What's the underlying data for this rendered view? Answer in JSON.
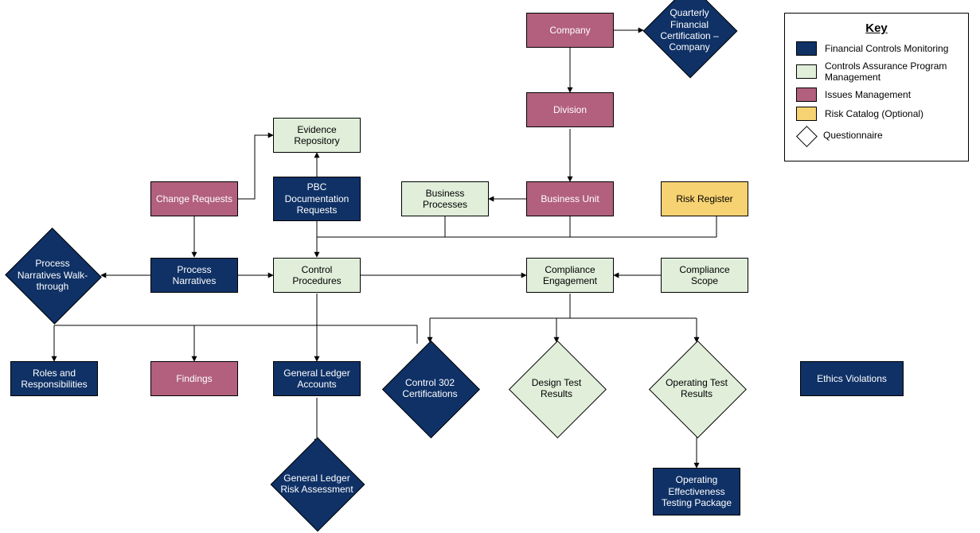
{
  "nodes": {
    "company": "Company",
    "quarterlyFinCert": "Quarterly Financial Certification – Company",
    "division": "Division",
    "evidenceRepo": "Evidence Repository",
    "changeRequests": "Change Requests",
    "pbcDocRequests": "PBC Documentation Requests",
    "bizProcesses": "Business Processes",
    "businessUnit": "Business Unit",
    "riskRegister": "Risk Register",
    "processNarrWalk": "Process Narratives Walk-through",
    "processNarratives": "Process Narratives",
    "controlProcedures": "Control Procedures",
    "complianceEngagement": "Compliance Engagement",
    "complianceScope": "Compliance Scope",
    "rolesResp": "Roles and Responsibilities",
    "findings": "Findings",
    "glAccounts": "General Ledger Accounts",
    "control302": "Control 302 Certifications",
    "designTest": "Design Test Results",
    "operatingTest": "Operating Test Results",
    "glRiskAssess": "General Ledger Risk Assessment",
    "opEffTestPkg": "Operating Effectiveness Testing Package",
    "ethicsViolations": "Ethics Violations"
  },
  "legend": {
    "title": "Key",
    "items": {
      "finCtrlMon": "Financial Controls Monitoring",
      "ctrlAssurPM": "Controls Assurance Program Management",
      "issuesMgmt": "Issues Management",
      "riskCatalog": "Risk Catalog (Optional)",
      "questionnaire": "Questionnaire"
    }
  }
}
